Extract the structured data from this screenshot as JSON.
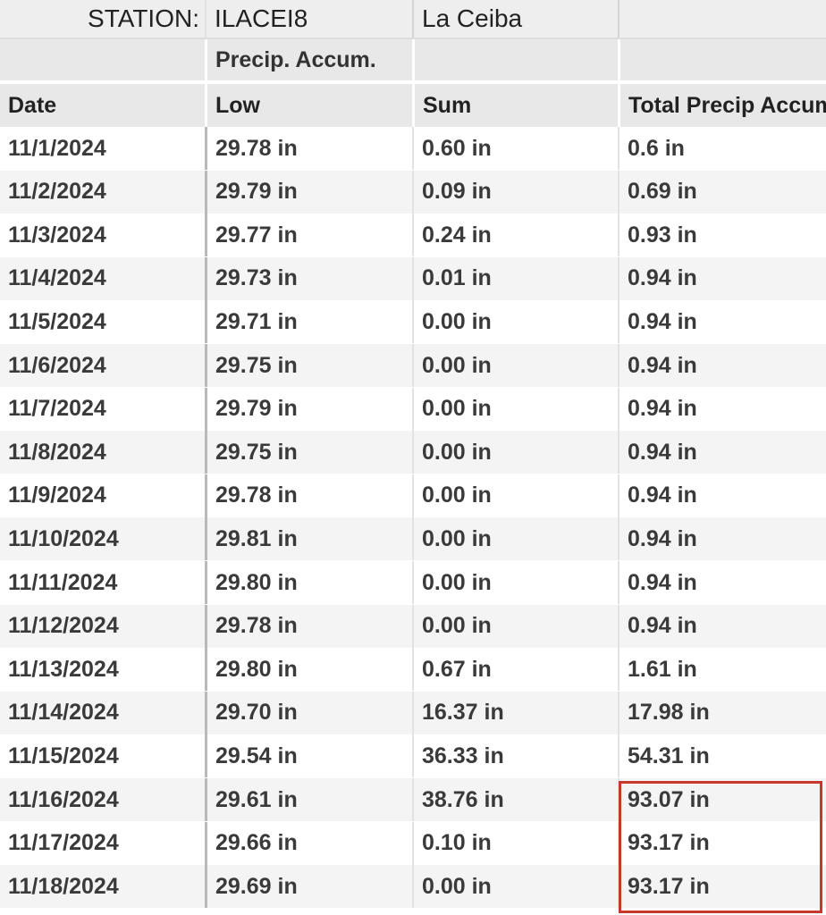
{
  "station": {
    "label": "STATION:",
    "id": "ILACEI8",
    "name": "La Ceiba"
  },
  "group_header": {
    "precip_accum": "Precip. Accum."
  },
  "columns": [
    "Date",
    "Low",
    "Sum",
    "Total Precip Accum"
  ],
  "rows": [
    {
      "date": "11/1/2024",
      "low": "29.78 in",
      "sum": "0.60 in",
      "total": "0.6 in"
    },
    {
      "date": "11/2/2024",
      "low": "29.79 in",
      "sum": "0.09 in",
      "total": "0.69 in"
    },
    {
      "date": "11/3/2024",
      "low": "29.77 in",
      "sum": "0.24 in",
      "total": "0.93 in"
    },
    {
      "date": "11/4/2024",
      "low": "29.73 in",
      "sum": "0.01 in",
      "total": "0.94 in"
    },
    {
      "date": "11/5/2024",
      "low": "29.71 in",
      "sum": "0.00 in",
      "total": "0.94 in"
    },
    {
      "date": "11/6/2024",
      "low": "29.75 in",
      "sum": "0.00 in",
      "total": "0.94 in"
    },
    {
      "date": "11/7/2024",
      "low": "29.79 in",
      "sum": "0.00 in",
      "total": "0.94 in"
    },
    {
      "date": "11/8/2024",
      "low": "29.75 in",
      "sum": "0.00 in",
      "total": "0.94 in"
    },
    {
      "date": "11/9/2024",
      "low": "29.78 in",
      "sum": "0.00 in",
      "total": "0.94 in"
    },
    {
      "date": "11/10/2024",
      "low": "29.81 in",
      "sum": "0.00 in",
      "total": "0.94 in"
    },
    {
      "date": "11/11/2024",
      "low": "29.80 in",
      "sum": "0.00 in",
      "total": "0.94 in"
    },
    {
      "date": "11/12/2024",
      "low": "29.78 in",
      "sum": "0.00 in",
      "total": "0.94 in"
    },
    {
      "date": "11/13/2024",
      "low": "29.80 in",
      "sum": "0.67 in",
      "total": "1.61 in"
    },
    {
      "date": "11/14/2024",
      "low": "29.70 in",
      "sum": "16.37 in",
      "total": "17.98 in"
    },
    {
      "date": "11/15/2024",
      "low": "29.54 in",
      "sum": "36.33 in",
      "total": "54.31 in"
    },
    {
      "date": "11/16/2024",
      "low": "29.61 in",
      "sum": "38.76 in",
      "total": "93.07 in"
    },
    {
      "date": "11/17/2024",
      "low": "29.66 in",
      "sum": "0.10 in",
      "total": "93.17 in"
    },
    {
      "date": "11/18/2024",
      "low": "29.69 in",
      "sum": "0.00 in",
      "total": "93.17 in"
    }
  ],
  "highlight": {
    "color": "#c8372d",
    "rows": [
      "11/16/2024",
      "11/17/2024",
      "11/18/2024"
    ]
  }
}
